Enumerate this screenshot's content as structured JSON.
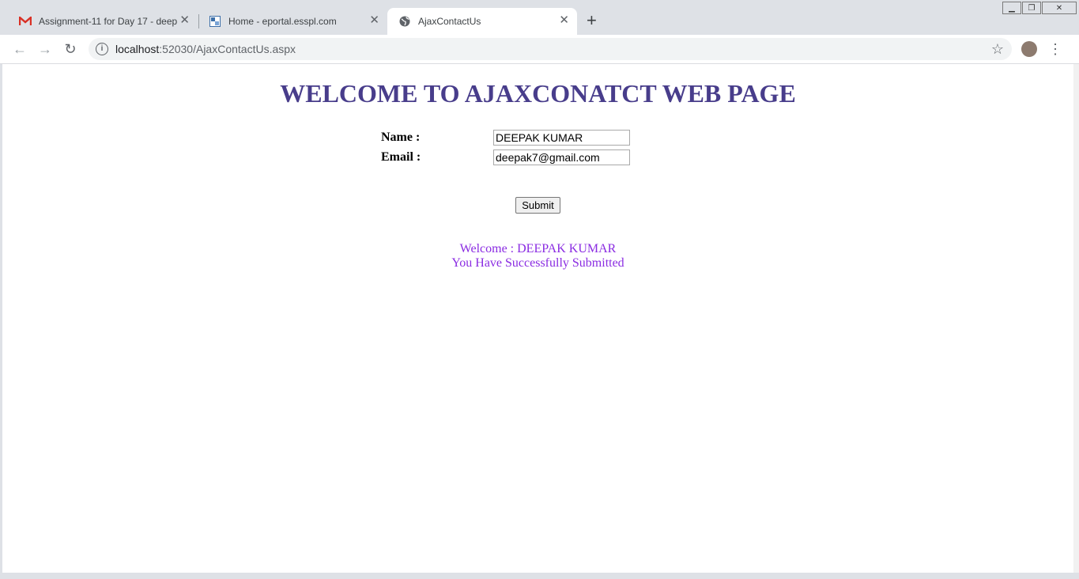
{
  "browser": {
    "tabs": [
      {
        "title": "Assignment-11 for Day 17 - deep",
        "icon": "gmail-icon",
        "active": false
      },
      {
        "title": "Home - eportal.esspl.com",
        "icon": "site-icon",
        "active": false
      },
      {
        "title": "AjaxContactUs",
        "icon": "globe-icon",
        "active": true
      }
    ],
    "url_host": "localhost",
    "url_rest": ":52030/AjaxContactUs.aspx"
  },
  "page": {
    "title": "WELCOME TO AJAXCONATCT WEB PAGE",
    "name_label": "Name :",
    "name_value": "DEEPAK KUMAR",
    "email_label": "Email :",
    "email_value": "deepak7@gmail.com",
    "submit_label": "Submit",
    "welcome_line": "Welcome : DEEPAK KUMAR",
    "success_line": "You Have Successfully Submitted"
  },
  "colors": {
    "title": "#483d8b",
    "result_text": "#8a2be2"
  }
}
